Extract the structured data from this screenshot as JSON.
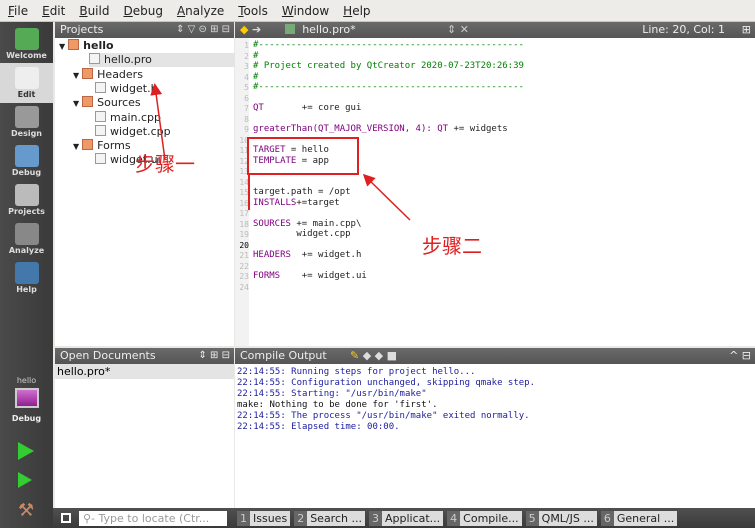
{
  "menu": [
    "File",
    "Edit",
    "Build",
    "Debug",
    "Analyze",
    "Tools",
    "Window",
    "Help"
  ],
  "modes": [
    {
      "label": "Welcome",
      "icon": "qt-logo-icon"
    },
    {
      "label": "Edit",
      "icon": "edit-document-icon"
    },
    {
      "label": "Design",
      "icon": "design-icon"
    },
    {
      "label": "Debug",
      "icon": "debug-icon"
    },
    {
      "label": "Projects",
      "icon": "projects-icon"
    },
    {
      "label": "Analyze",
      "icon": "analyze-icon"
    },
    {
      "label": "Help",
      "icon": "help-icon"
    }
  ],
  "target": {
    "project": "hello",
    "config": "Debug"
  },
  "projects": {
    "title": "Projects",
    "tree": [
      {
        "label": "hello",
        "bold": true,
        "level": 0,
        "expanded": true
      },
      {
        "label": "hello.pro",
        "level": 1,
        "selected": true
      },
      {
        "label": "Headers",
        "level": 1,
        "expanded": true
      },
      {
        "label": "widget.h",
        "level": 2
      },
      {
        "label": "Sources",
        "level": 1,
        "expanded": true
      },
      {
        "label": "main.cpp",
        "level": 2
      },
      {
        "label": "widget.cpp",
        "level": 2
      },
      {
        "label": "Forms",
        "level": 1,
        "expanded": true
      },
      {
        "label": "widget.ui",
        "level": 2
      }
    ]
  },
  "editor": {
    "file": "hello.pro*",
    "position": "Line: 20, Col: 1",
    "current_line": 20,
    "lines": [
      "#-------------------------------------------------",
      "#",
      "# Project created by QtCreator 2020-07-23T20:26:39",
      "#",
      "#-------------------------------------------------",
      "",
      "QT       += core gui",
      "",
      "greaterThan(QT_MAJOR_VERSION, 4): QT += widgets",
      "",
      "TARGET = hello",
      "TEMPLATE = app",
      "",
      "",
      "target.path = /opt",
      "INSTALLS+=target",
      "",
      "SOURCES += main.cpp\\",
      "        widget.cpp",
      "",
      "HEADERS  += widget.h",
      "",
      "FORMS    += widget.ui",
      ""
    ]
  },
  "open_documents": {
    "title": "Open Documents",
    "items": [
      "hello.pro*"
    ]
  },
  "compile_output": {
    "title": "Compile Output",
    "lines": [
      {
        "text": "22:14:55: Running steps for project hello...",
        "color": "#2020a0"
      },
      {
        "text": "22:14:55: Configuration unchanged, skipping qmake step.",
        "color": "#2020a0"
      },
      {
        "text": "22:14:55: Starting: \"/usr/bin/make\"",
        "color": "#2020a0"
      },
      {
        "text": "make: Nothing to be done for 'first'.",
        "color": "#111111"
      },
      {
        "text": "22:14:55: The process \"/usr/bin/make\" exited normally.",
        "color": "#2020a0"
      },
      {
        "text": "22:14:55: Elapsed time: 00:00.",
        "color": "#2020a0"
      }
    ]
  },
  "locator": {
    "placeholder": "Type to locate (Ctr..."
  },
  "output_tabs": [
    {
      "n": "1",
      "label": "Issues"
    },
    {
      "n": "2",
      "label": "Search ..."
    },
    {
      "n": "3",
      "label": "Applicat..."
    },
    {
      "n": "4",
      "label": "Compile..."
    },
    {
      "n": "5",
      "label": "QML/JS ..."
    },
    {
      "n": "6",
      "label": "General ..."
    }
  ],
  "annotations": {
    "step1": "步骤一",
    "step2": "步骤二",
    "color": "#e02020"
  }
}
